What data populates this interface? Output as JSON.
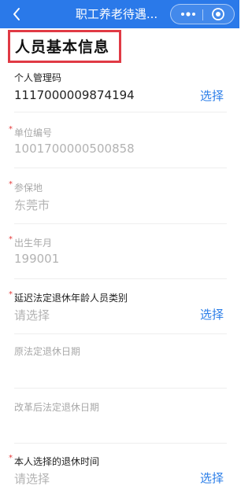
{
  "nav": {
    "title": "职工养老待遇...",
    "back_icon": "chevron-left-icon",
    "more_icon": "more-dots-icon",
    "close_icon": "target-circle-icon",
    "background": "#2a79e9"
  },
  "section": {
    "title": "人员基本信息",
    "highlight_color": "#e03a45"
  },
  "fields": {
    "personal_code": {
      "label": "个人管理码",
      "value": "1117000009874194",
      "action": "选择"
    },
    "unit_number": {
      "required": "*",
      "label": "单位编号",
      "value": "1001700000500858"
    },
    "insured_place": {
      "required": "*",
      "label": "参保地",
      "value": "东莞市"
    },
    "birth_month": {
      "required": "*",
      "label": "出生年月",
      "value": "199001"
    },
    "delay_category": {
      "required": "*",
      "label": "延迟法定退休年龄人员类别",
      "placeholder": "请选择",
      "action": "选择"
    },
    "original_retire_date": {
      "label": "原法定退休日期"
    },
    "reformed_retire_date": {
      "label": "改革后法定退休日期"
    },
    "chosen_retire_time": {
      "required": "*",
      "label": "本人选择的退休时间",
      "placeholder": "请选择",
      "action": "选择"
    }
  },
  "colors": {
    "link": "#2d7fe8",
    "required": "#e53a3a"
  }
}
